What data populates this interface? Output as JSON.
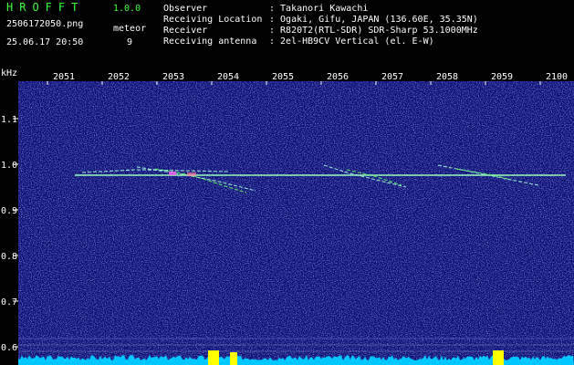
{
  "app": {
    "name": "HROFFT",
    "version": "1.0.0"
  },
  "capture": {
    "filename": "2506172050.png",
    "datetime": "25.06.17 20:50",
    "meteor_label": "meteor",
    "meteor_count": "9"
  },
  "info": [
    {
      "label": "Observer",
      "value": ": Takanori Kawachi"
    },
    {
      "label": "Receiving Location",
      "value": ": Ogaki, Gifu, JAPAN (136.60E, 35.35N)"
    },
    {
      "label": "Receiver",
      "value": ": R820T2(RTL-SDR) SDR-Sharp 53.1000MHz"
    },
    {
      "label": "Receiving antenna",
      "value": ": 2el-HB9CV Vertical (el. E-W)"
    }
  ],
  "spectrogram": {
    "y_unit": "kHz",
    "y_ticks": [
      "1.1",
      "1.0",
      "0.9",
      "0.8",
      "0.7",
      "0.6"
    ],
    "x_ticks": [
      "2051",
      "2052",
      "2053",
      "2054",
      "2055",
      "2056",
      "2057",
      "2058",
      "2059",
      "2100"
    ],
    "colors": {
      "background": "#0c0c6e",
      "noise": "#2a33b0",
      "carrier": "#a8ffe0",
      "meteor": "#5cff5c",
      "tick_text": "#ffffff",
      "amplitude": "#00c8ff",
      "burst": "#ffff00"
    }
  }
}
